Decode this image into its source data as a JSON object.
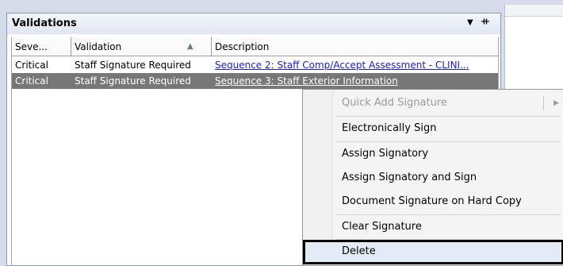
{
  "panel": {
    "title": "Validations",
    "dropdown_glyph": "▼",
    "pin_glyph": "ᚌ"
  },
  "grid": {
    "columns": [
      "Seve...",
      "Validation",
      "Description"
    ],
    "sort_glyph": "▲",
    "rows": [
      {
        "severity": "Critical",
        "validation": "Staff Signature Required",
        "description": "Sequence 2: Staff Comp/Accept Assessment - CLINI..."
      },
      {
        "severity": "Critical",
        "validation": "Staff Signature Required",
        "description": "Sequence 3: Staff Exterior Information"
      }
    ]
  },
  "context_menu": {
    "items": [
      {
        "label": "Quick Add Signature",
        "disabled": true
      },
      {
        "label": "Electronically Sign"
      },
      {
        "label": "Assign Signatory"
      },
      {
        "label": "Assign Signatory and Sign"
      },
      {
        "label": "Document Signature on Hard Copy"
      },
      {
        "label": "Clear Signature"
      },
      {
        "label": "Delete"
      }
    ],
    "submenu_glyph": "▶"
  }
}
